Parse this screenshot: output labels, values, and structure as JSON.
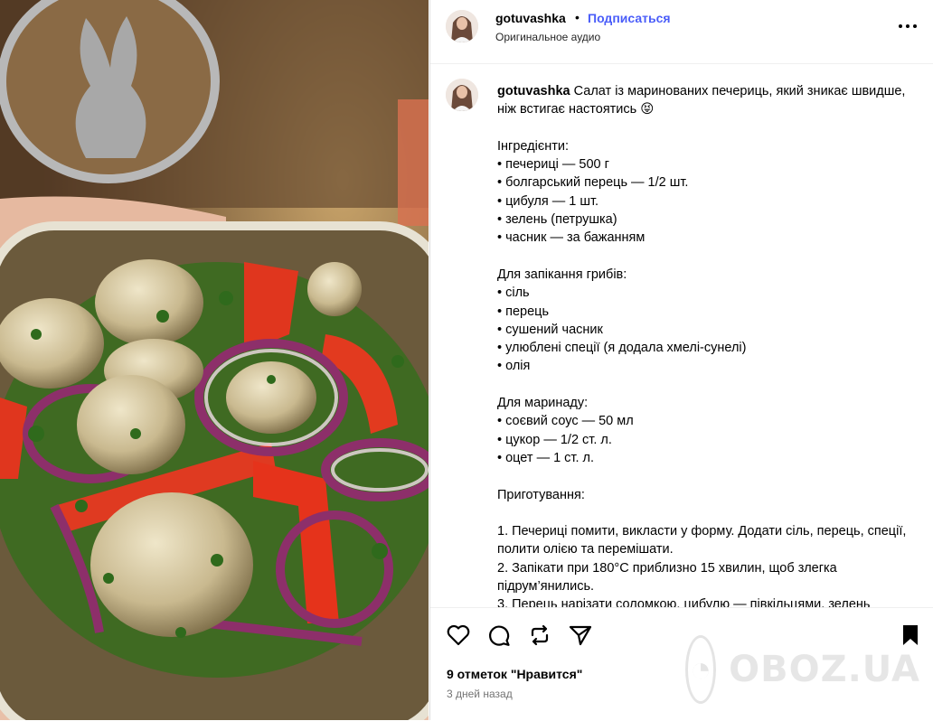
{
  "post": {
    "username": "gotuvashka",
    "separator": "•",
    "follow_label": "Подписаться",
    "audio_label": "Оригинальное аудио",
    "caption_user": "gotuvashka",
    "caption_text": " Салат із маринованих печериць, який зникає швидше, ніж встигає настоятись 😝\n\nІнгредієнти:\n• печериці — 500 г\n• болгарський перець — 1/2 шт.\n• цибуля — 1 шт.\n• зелень (петрушка)\n• часник — за бажанням\n\nДля запікання грибів:\n• сіль\n• перець\n• сушений часник\n• улюблені спеції (я додала хмелі-сунелі)\n• олія\n\nДля маринаду:\n• соєвий соус — 50 мл\n• цукор — 1/2 ст. л.\n• оцет — 1 ст. л.\n\nПриготування:\n\n1. Печериці помити, викласти у форму. Додати сіль, перець, спеції, полити олією та перемішати.\n2. Запікати при 180°C приблизно 15 хвилин, щоб злегка підрум’янились.\n3. Перець нарізати соломкою, цибулю — півкільцями, зелень",
    "likes_text": "9 отметок \"Нравится\"",
    "time_text": "3 дней назад"
  },
  "icons": {
    "like": "heart-icon",
    "comment": "comment-icon",
    "share": "repost-icon",
    "send": "send-icon",
    "save": "bookmark-icon",
    "more": "more-icon"
  },
  "watermark": {
    "text": "OBOZ.UA"
  },
  "colors": {
    "follow": "#4a5df9",
    "border": "#dbdbdb",
    "muted": "#737373"
  }
}
